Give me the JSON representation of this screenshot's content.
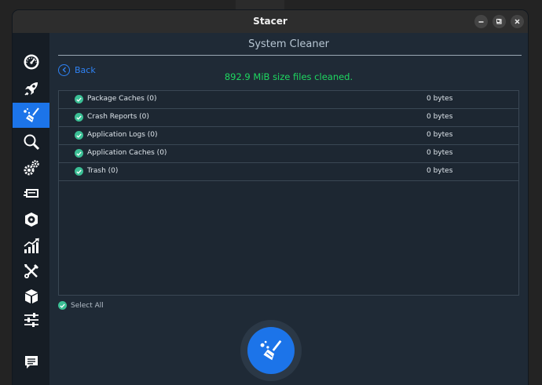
{
  "window": {
    "title": "Stacer",
    "controls": [
      "minimize-icon",
      "maximize-icon",
      "close-icon"
    ]
  },
  "sidebar": {
    "items": [
      {
        "name": "dashboard",
        "icon": "speedometer-icon",
        "active": false
      },
      {
        "name": "startup-apps",
        "icon": "rocket-icon",
        "active": false
      },
      {
        "name": "system-cleaner",
        "icon": "broom-icon",
        "active": true
      },
      {
        "name": "search",
        "icon": "magnifier-icon",
        "active": false
      },
      {
        "name": "services",
        "icon": "gears-icon",
        "active": false
      },
      {
        "name": "processes",
        "icon": "processes-icon",
        "active": false
      },
      {
        "name": "uninstaller",
        "icon": "disk-icon",
        "active": false
      },
      {
        "name": "resources",
        "icon": "chart-icon",
        "active": false
      },
      {
        "name": "helpers",
        "icon": "tools-icon",
        "active": false
      },
      {
        "name": "apt-repository",
        "icon": "package-icon",
        "active": false
      },
      {
        "name": "settings",
        "icon": "sliders-icon",
        "active": false
      },
      {
        "name": "feedback",
        "icon": "chat-icon",
        "active": false
      }
    ]
  },
  "main": {
    "page_title": "System Cleaner",
    "back_label": "Back",
    "status_message": "892.9 MiB size files cleaned.",
    "categories": [
      {
        "label": "Package Caches (0)",
        "size": "0 bytes"
      },
      {
        "label": "Crash Reports (0)",
        "size": "0 bytes"
      },
      {
        "label": "Application Logs (0)",
        "size": "0 bytes"
      },
      {
        "label": "Application Caches (0)",
        "size": "0 bytes"
      },
      {
        "label": "Trash (0)",
        "size": "0 bytes"
      }
    ],
    "select_all_label": "Select All"
  },
  "colors": {
    "accent": "#1c74e9",
    "success": "#1ed760",
    "checkbox": "#3bbf95",
    "window_bg": "#1f2a36",
    "sidebar_bg": "#161d25"
  }
}
